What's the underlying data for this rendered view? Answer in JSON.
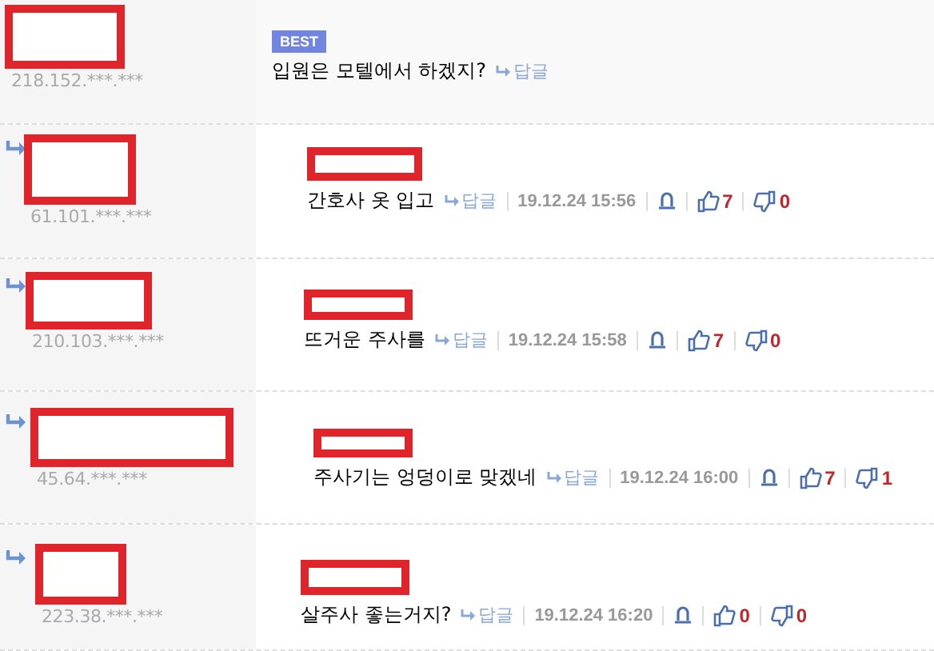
{
  "comments": [
    {
      "badge": "BEST",
      "reply": false,
      "ip": "218.152.***.***",
      "text": "입원은 모텔에서 하겠지?",
      "reply_link": "답글"
    },
    {
      "reply": true,
      "ip": "61.101.***.***",
      "text": "간호사 옷 입고",
      "reply_link": "답글",
      "date": "19.12.24 15:56",
      "likes": "7",
      "dislikes": "0"
    },
    {
      "reply": true,
      "ip": "210.103.***.***",
      "text": "뜨거운 주사를",
      "reply_link": "답글",
      "date": "19.12.24 15:58",
      "likes": "7",
      "dislikes": "0"
    },
    {
      "reply": true,
      "ip": "45.64.***.***",
      "text": "주사기는 엉덩이로 맞겠네",
      "reply_link": "답글",
      "date": "19.12.24 16:00",
      "likes": "7",
      "dislikes": "1"
    },
    {
      "reply": true,
      "ip": "223.38.***.***",
      "text": "살주사 좋는거지?",
      "reply_link": "답글",
      "date": "19.12.24 16:20",
      "likes": "0",
      "dislikes": "0"
    }
  ]
}
